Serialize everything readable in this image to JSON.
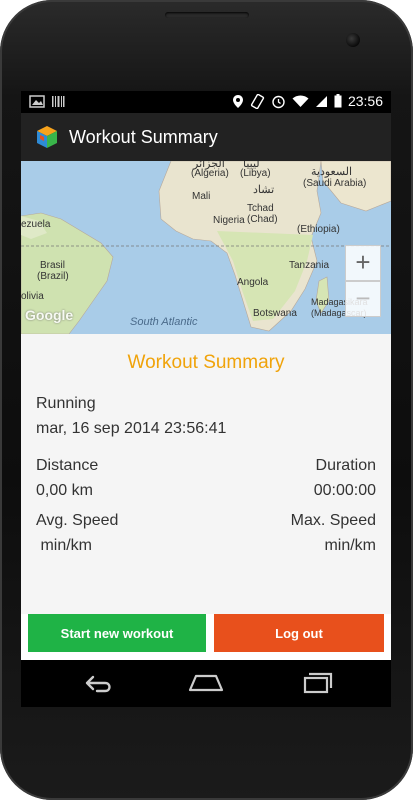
{
  "status_bar": {
    "time": "23:56",
    "icons": [
      "image-icon",
      "barcode-icon",
      "location-icon",
      "rotate-icon",
      "alarm-icon",
      "wifi-icon",
      "signal-icon",
      "battery-icon"
    ]
  },
  "action_bar": {
    "title": "Workout Summary",
    "icon": "app-cube-icon"
  },
  "map": {
    "labels": [
      "(Algeria)",
      "(Libya)",
      "السعودية",
      "(Saudi Arabia)",
      "تشاد",
      "Mali",
      "Tchad",
      "(Chad)",
      "Nigeria",
      "(Ethiopia)",
      "ezuela",
      "Brasil",
      "(Brazil)",
      "Tanzania",
      "Angola",
      "olivia",
      "Madagasikara",
      "(Madagascar)",
      "Botswana",
      "South Atlantic",
      "Google",
      "الجزائر",
      "ليبيا"
    ],
    "zoom_in": "+",
    "zoom_out": "−"
  },
  "summary": {
    "title": "Workout Summary",
    "activity": "Running",
    "date": "mar, 16 sep 2014 23:56:41",
    "distance_label": "Distance",
    "distance_value": "0,00 km",
    "duration_label": "Duration",
    "duration_value": "00:00:00",
    "avg_speed_label": "Avg. Speed",
    "avg_speed_value": " min/km",
    "max_speed_label": "Max. Speed",
    "max_speed_value": "min/km"
  },
  "buttons": {
    "start_new_workout": "Start new workout",
    "log_out": "Log out"
  },
  "colors": {
    "accent": "#f0a30a",
    "start_button": "#1fb346",
    "logout_button": "#e8501c",
    "action_bar": "#222222"
  },
  "nav_bar": {
    "icons": [
      "back-icon",
      "home-icon",
      "recent-apps-icon"
    ]
  }
}
